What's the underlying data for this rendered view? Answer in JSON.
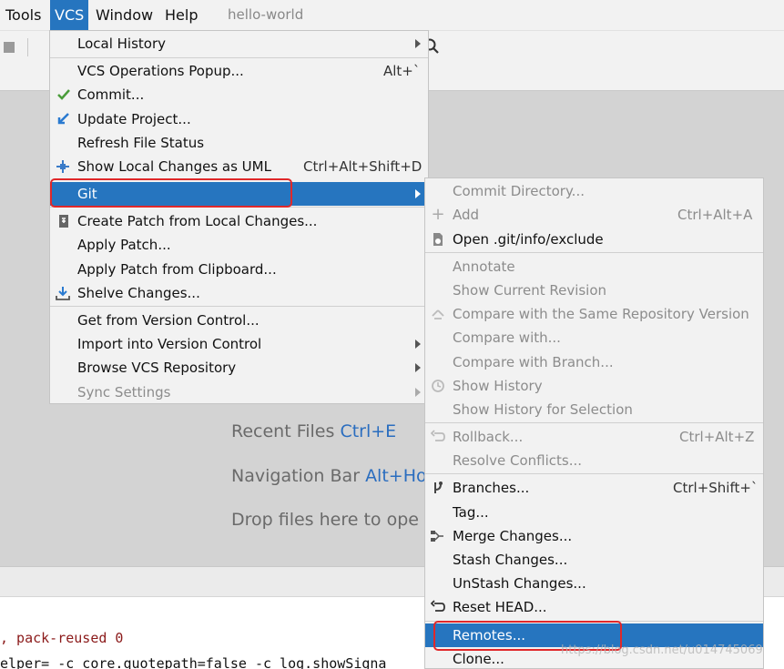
{
  "menubar": {
    "items": [
      "Tools",
      "VCS",
      "Window",
      "Help"
    ],
    "project_title": "hello-world"
  },
  "editor_hints": {
    "recent_files": {
      "label": "Recent Files",
      "shortcut": "Ctrl+E"
    },
    "navigation_bar": {
      "label": "Navigation Bar",
      "shortcut": "Alt+Ho"
    },
    "drop_files": {
      "label": "Drop files here to ope"
    }
  },
  "console": {
    "line1": ", pack-reused 0",
    "line2": "elper= -c core.quotepath=false -c log.showSigna"
  },
  "vcs_menu": {
    "items": [
      {
        "label": "Local History",
        "shortcut": "",
        "submenu": true
      },
      {
        "label": "VCS Operations Popup...",
        "shortcut": "Alt+`"
      },
      {
        "label": "Commit...",
        "icon": "check-icon"
      },
      {
        "label": "Update Project...",
        "icon": "update-arrow-icon"
      },
      {
        "label": "Refresh File Status"
      },
      {
        "label": "Show Local Changes as UML",
        "shortcut": "Ctrl+Alt+Shift+D",
        "icon": "uml-icon"
      },
      {
        "label": "Git",
        "submenu": true,
        "selected": true
      },
      {
        "label": "Create Patch from Local Changes...",
        "icon": "patch-icon"
      },
      {
        "label": "Apply Patch..."
      },
      {
        "label": "Apply Patch from Clipboard..."
      },
      {
        "label": "Shelve Changes...",
        "icon": "shelve-icon"
      },
      {
        "label": "Get from Version Control..."
      },
      {
        "label": "Import into Version Control",
        "submenu": true
      },
      {
        "label": "Browse VCS Repository",
        "submenu": true
      },
      {
        "label": "Sync Settings",
        "submenu": true,
        "disabled": true
      }
    ]
  },
  "git_menu": {
    "items": [
      {
        "label": "Commit Directory...",
        "disabled": true
      },
      {
        "label": "Add",
        "shortcut": "Ctrl+Alt+A",
        "disabled": true,
        "icon": "plus-icon"
      },
      {
        "label": "Open .git/info/exclude",
        "icon": "file-icon"
      },
      {
        "label": "Annotate",
        "disabled": true
      },
      {
        "label": "Show Current Revision",
        "disabled": true
      },
      {
        "label": "Compare with the Same Repository Version",
        "disabled": true,
        "icon": "compare-icon"
      },
      {
        "label": "Compare with...",
        "disabled": true
      },
      {
        "label": "Compare with Branch...",
        "disabled": true
      },
      {
        "label": "Show History",
        "disabled": true,
        "icon": "clock-icon"
      },
      {
        "label": "Show History for Selection",
        "disabled": true
      },
      {
        "label": "Rollback...",
        "shortcut": "Ctrl+Alt+Z",
        "disabled": true,
        "icon": "rollback-icon"
      },
      {
        "label": "Resolve Conflicts...",
        "disabled": true
      },
      {
        "label": "Branches...",
        "shortcut": "Ctrl+Shift+`",
        "icon": "branch-icon"
      },
      {
        "label": "Tag..."
      },
      {
        "label": "Merge Changes...",
        "icon": "merge-icon"
      },
      {
        "label": "Stash Changes..."
      },
      {
        "label": "UnStash Changes..."
      },
      {
        "label": "Reset HEAD...",
        "icon": "reset-icon"
      },
      {
        "label": "Remotes...",
        "selected": true
      },
      {
        "label": "Clone..."
      }
    ]
  },
  "watermark": "https://blog.csdn.net/u014745069",
  "colors": {
    "accent": "#2675bf",
    "highlight": "#e0282a",
    "menu_bg": "#f2f2f2"
  }
}
